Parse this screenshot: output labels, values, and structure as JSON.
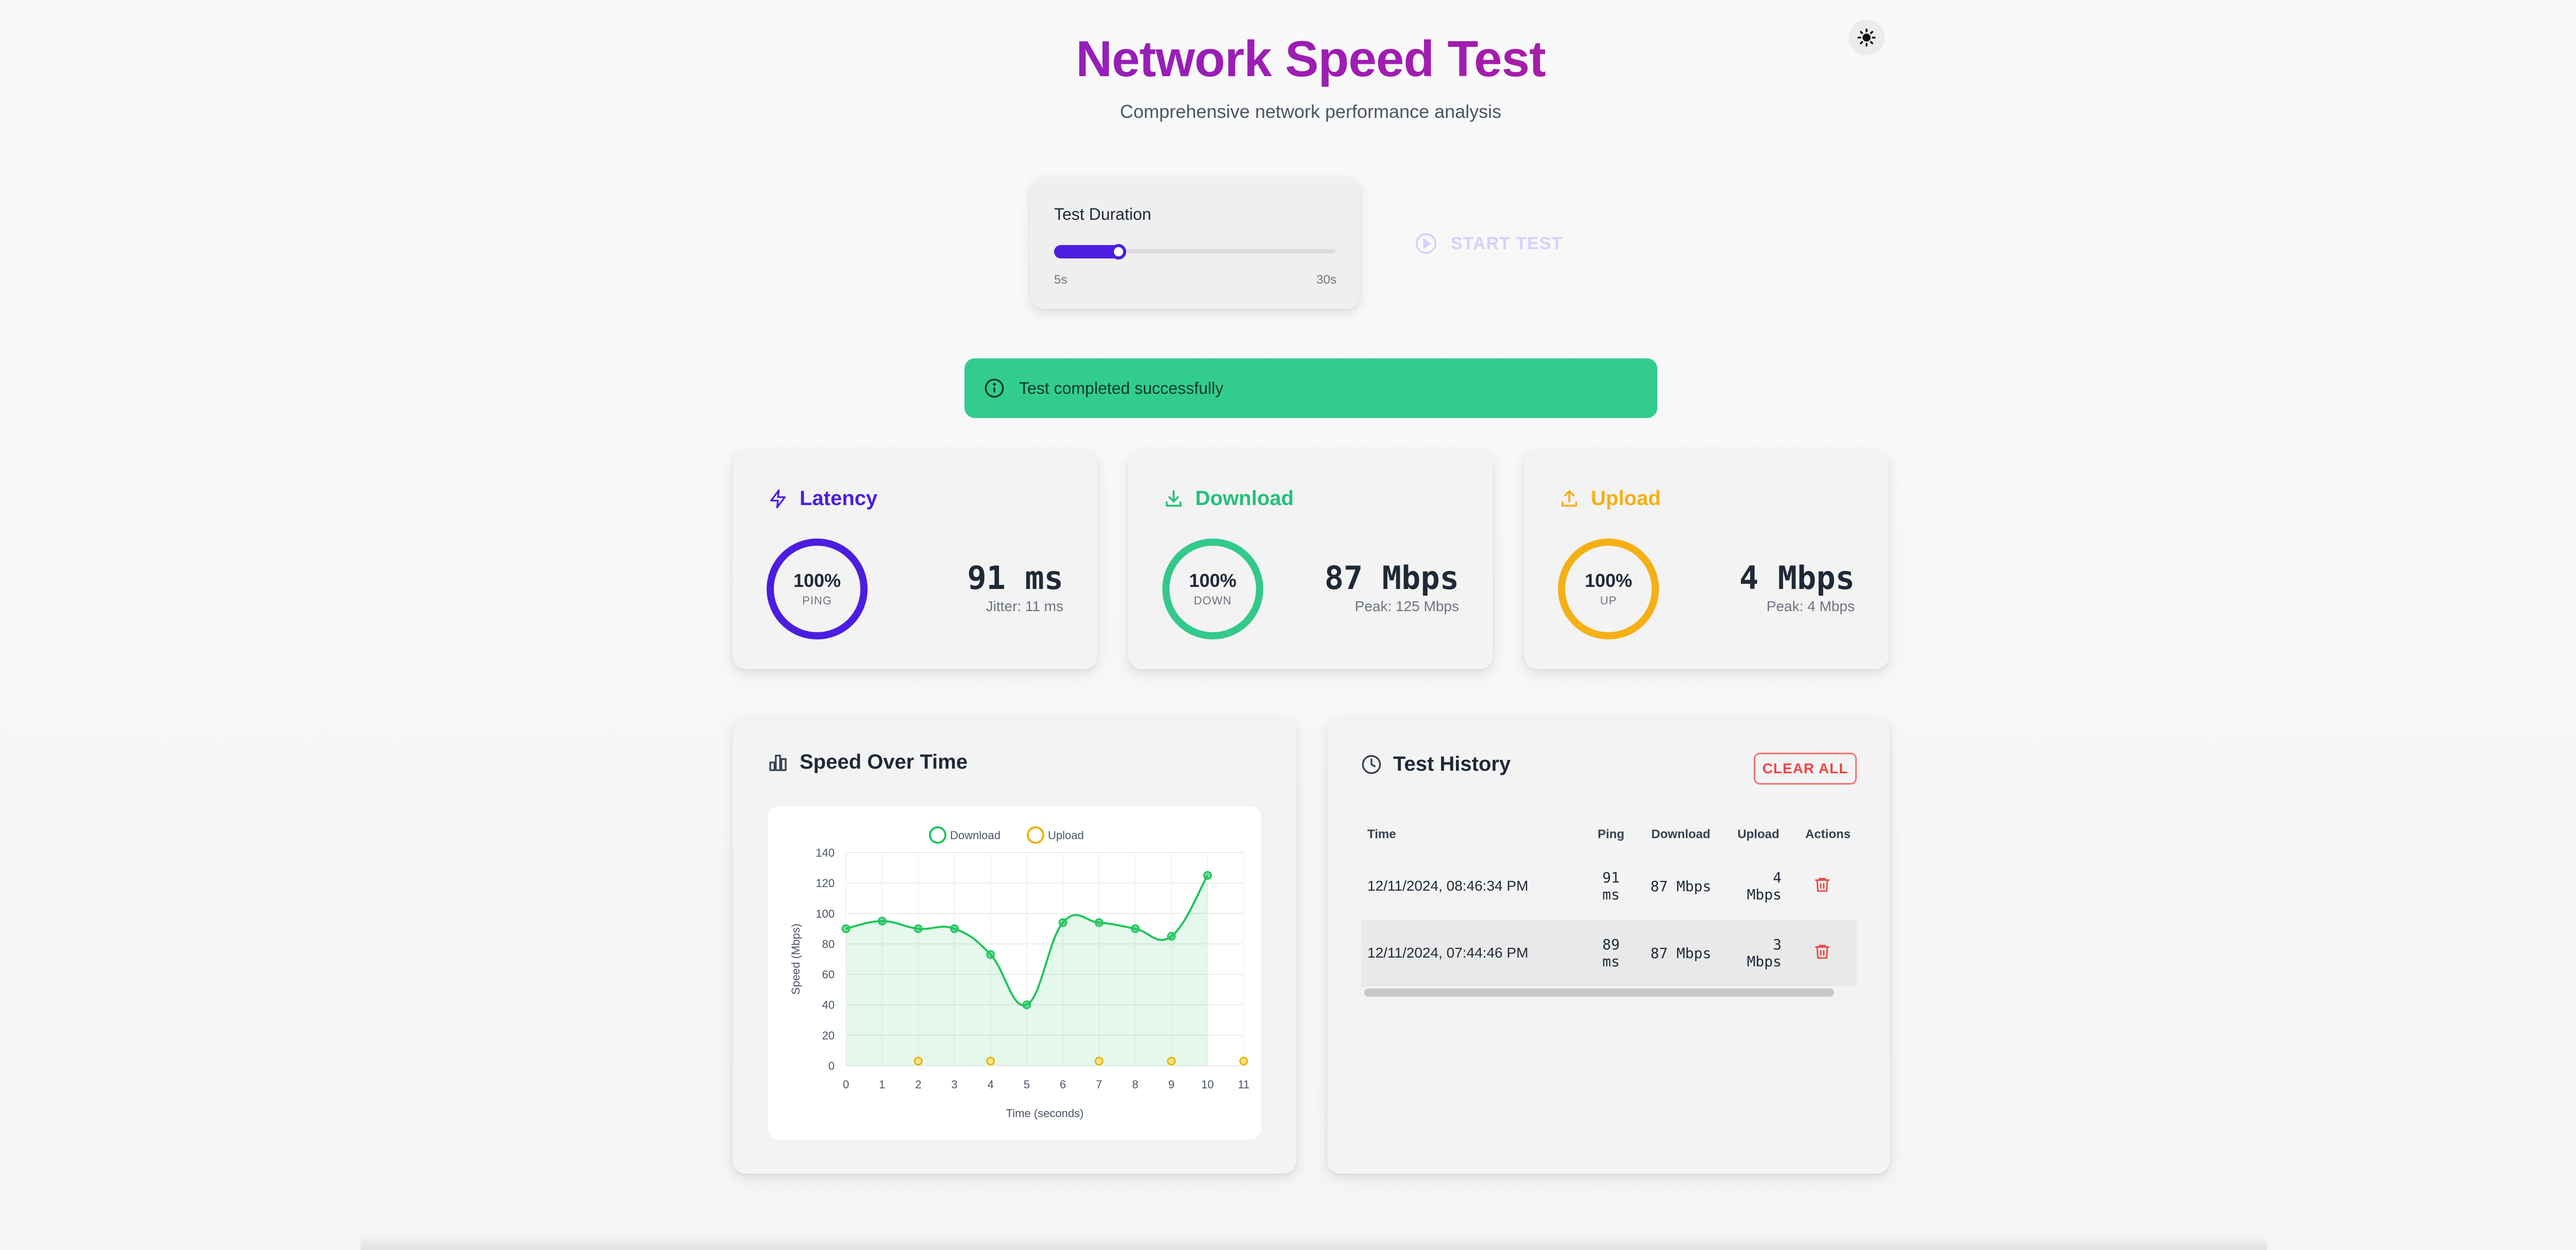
{
  "header": {
    "title": "Network Speed Test",
    "subtitle": "Comprehensive network performance analysis",
    "theme_toggle_icon": "sun-icon"
  },
  "duration": {
    "label": "Test Duration",
    "min_label": "5s",
    "max_label": "30s",
    "value_fraction": 0.22
  },
  "start_button": {
    "label": "START TEST",
    "icon": "play-circle-icon",
    "disabled": true
  },
  "alert": {
    "text": "Test completed successfully",
    "icon": "info-icon",
    "color": "#33cc8f"
  },
  "metrics": {
    "latency": {
      "title": "Latency",
      "icon": "bolt-icon",
      "color": "#4c1de0",
      "percent": "100%",
      "ring_label": "PING",
      "value": "91 ms",
      "sub": "Jitter: 11 ms"
    },
    "download": {
      "title": "Download",
      "icon": "download-icon",
      "color": "#22c07a",
      "percent": "100%",
      "ring_label": "DOWN",
      "value": "87 Mbps",
      "sub": "Peak: 125 Mbps"
    },
    "upload": {
      "title": "Upload",
      "icon": "upload-icon",
      "color": "#f5b014",
      "percent": "100%",
      "ring_label": "UP",
      "value": "4 Mbps",
      "sub": "Peak: 4 Mbps"
    }
  },
  "speed_chart": {
    "title": "Speed Over Time",
    "icon": "bar-chart-icon"
  },
  "chart_data": {
    "type": "line",
    "xlabel": "Time (seconds)",
    "ylabel": "Speed (Mbps)",
    "x": [
      0,
      1,
      2,
      3,
      4,
      5,
      6,
      7,
      8,
      9,
      10,
      11
    ],
    "ylim": [
      0,
      140
    ],
    "yticks": [
      0,
      20,
      40,
      60,
      80,
      100,
      120,
      140
    ],
    "legend_position": "top-center",
    "grid": true,
    "series": [
      {
        "name": "Download",
        "color": "#22c55e",
        "fill": true,
        "points": [
          [
            0,
            90
          ],
          [
            1,
            95
          ],
          [
            2,
            90
          ],
          [
            3,
            90
          ],
          [
            4,
            73
          ],
          [
            5,
            40
          ],
          [
            6,
            94
          ],
          [
            7,
            94
          ],
          [
            8,
            90
          ],
          [
            9,
            85
          ],
          [
            10,
            125
          ]
        ]
      },
      {
        "name": "Upload",
        "color": "#eab308",
        "fill": false,
        "points": [
          [
            2,
            3
          ],
          [
            4,
            3
          ],
          [
            7,
            3
          ],
          [
            9,
            3
          ],
          [
            11,
            3
          ]
        ]
      }
    ]
  },
  "history": {
    "title": "Test History",
    "icon": "clock-icon",
    "clear_label": "CLEAR ALL",
    "columns": [
      "Time",
      "Ping",
      "Download",
      "Upload",
      "Actions"
    ],
    "rows": [
      {
        "time": "12/11/2024, 08:46:34 PM",
        "ping": "91 ms",
        "download": "87 Mbps",
        "upload": "4 Mbps"
      },
      {
        "time": "12/11/2024, 07:44:46 PM",
        "ping": "89 ms",
        "download": "87 Mbps",
        "upload": "3 Mbps"
      }
    ]
  }
}
